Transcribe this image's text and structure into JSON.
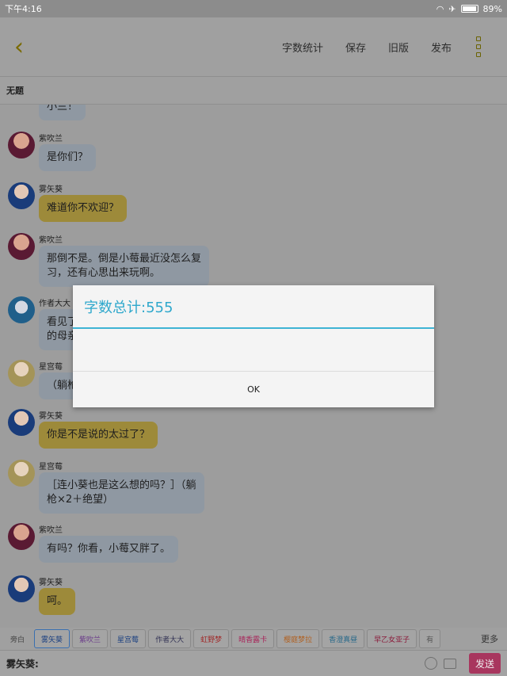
{
  "status": {
    "time": "下午4:16",
    "battery": "89%"
  },
  "toolbar": {
    "word_count": "字数统计",
    "save": "保存",
    "old_version": "旧版",
    "publish": "发布"
  },
  "title": "无题",
  "messages": [
    {
      "name": "",
      "text": "小兰！",
      "bubble": "gray"
    },
    {
      "name": "紫吹兰",
      "text": "是你们？",
      "bubble": "gray"
    },
    {
      "name": "雾矢葵",
      "text": "难道你不欢迎？",
      "bubble": "yellow"
    },
    {
      "name": "紫吹兰",
      "text": "那倒不是。倒是小莓最近没怎么复\n习，还有心思出来玩啊。",
      "bubble": "gray"
    },
    {
      "name": "作者大大",
      "text": "看见了\n的母亲",
      "bubble": "gray"
    },
    {
      "name": "星宫莓",
      "text": "（躺枪",
      "bubble": "gray"
    },
    {
      "name": "雾矢葵",
      "text": "你是不是说的太过了？",
      "bubble": "yellow"
    },
    {
      "name": "星宫莓",
      "text": "［连小葵也是这么想的吗？］（躺\n枪×2＋绝望）",
      "bubble": "gray"
    },
    {
      "name": "紫吹兰",
      "text": "有吗？你看，小莓又胖了。",
      "bubble": "gray"
    },
    {
      "name": "雾矢葵",
      "text": "呵。",
      "bubble": "yellow"
    }
  ],
  "tabs": [
    "旁白",
    "雾矢葵",
    "紫吹兰",
    "星宫莓",
    "作者大大",
    "虹野梦",
    "晴香露卡",
    "樱庭梦拉",
    "香澄真昼",
    "早乙女亚子",
    "有"
  ],
  "tab_colors": [
    "#444444",
    "#1a3f80",
    "#6a3a8a",
    "#1a3f80",
    "#333355",
    "#a02a2a",
    "#a8255a",
    "#b06020",
    "#2a6a8a",
    "#8a1a3a",
    "#555555"
  ],
  "more": "更多",
  "input": {
    "speaker": "雾矢葵:",
    "send": "发送"
  },
  "dialog": {
    "title": "字数总计:555",
    "ok": "OK"
  }
}
